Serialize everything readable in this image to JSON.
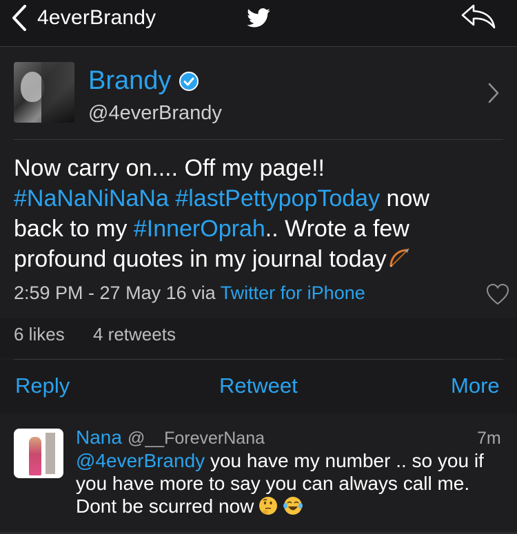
{
  "nav": {
    "title": "4everBrandy",
    "back_icon": "chevron-left-icon",
    "logo_icon": "twitter-bird-icon",
    "share_icon": "share-arrow-icon"
  },
  "profile": {
    "name": "Brandy",
    "handle": "@4everBrandy",
    "verified_icon": "verified-badge-icon"
  },
  "tweet": {
    "text_1": "Now carry on.... Off my page!!",
    "hashtag_1": "#NaNaNiNaNa",
    "hashtag_2": "#lastPettypopToday",
    "text_2": " now back to my ",
    "hashtag_3": "#InnerOprah",
    "text_3": ".. Wrote a few profound quotes in my journal today",
    "emoji": "bow-and-arrow-emoji",
    "timestamp": "2:59 PM - 27 May 16 via ",
    "source": "Twitter for iPhone"
  },
  "stats": {
    "likes": "6 likes",
    "retweets": "4 retweets"
  },
  "actions": {
    "reply": "Reply",
    "retweet": "Retweet",
    "more": "More"
  },
  "reply_tweet": {
    "name": "Nana",
    "handle": "@__ForeverNana",
    "time": "7m",
    "mention": "@4everBrandy",
    "text": " you have my number .. so you if you have more to say you can always call me. Dont be scurred now",
    "emojis": [
      "thinking-face-emoji",
      "tears-of-joy-emoji"
    ]
  },
  "colors": {
    "accent": "#2aa3ef",
    "background": "#1e1e20",
    "navbar": "#171719"
  }
}
